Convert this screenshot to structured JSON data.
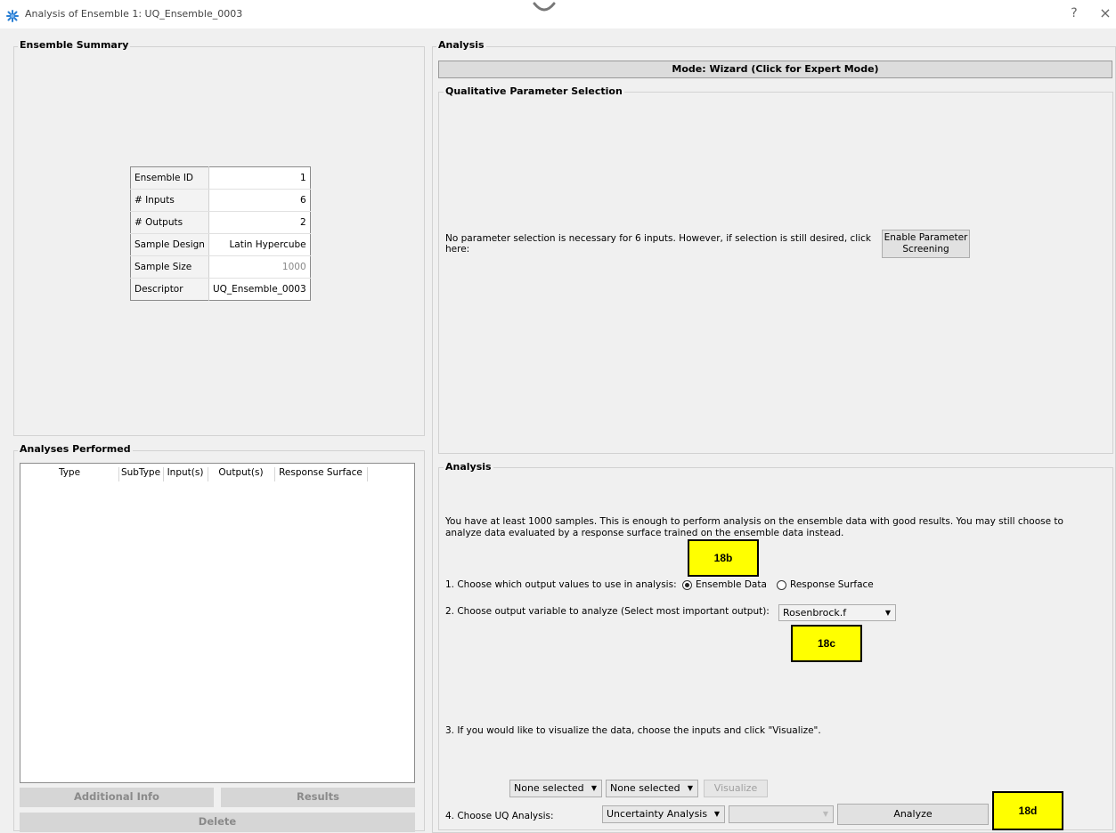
{
  "window": {
    "title": "Analysis of Ensemble 1: UQ_Ensemble_0003",
    "help_label": "?",
    "close_label": "×"
  },
  "ensemble_summary": {
    "title": "Ensemble Summary",
    "rows": [
      {
        "label": "Ensemble ID",
        "value": "1"
      },
      {
        "label": "# Inputs",
        "value": "6"
      },
      {
        "label": "# Outputs",
        "value": "2"
      },
      {
        "label": "Sample Design",
        "value": "Latin Hypercube"
      },
      {
        "label": "Sample Size",
        "value": "1000"
      },
      {
        "label": "Descriptor",
        "value": "UQ_Ensemble_0003"
      }
    ]
  },
  "analyses_performed": {
    "title": "Analyses Performed",
    "columns": [
      "Type",
      "SubType",
      "Input(s)",
      "Output(s)",
      "Response Surface"
    ],
    "buttons": {
      "additional_info": "Additional Info",
      "results": "Results",
      "delete": "Delete"
    }
  },
  "analysis_group": {
    "title": "Analysis",
    "mode_button": "Mode: Wizard (Click for Expert Mode)"
  },
  "qualitative": {
    "title": "Qualitative Parameter Selection",
    "message": "No parameter selection is necessary for 6 inputs. However, if selection is still desired, click here:",
    "enable_button_line1": "Enable Parameter",
    "enable_button_line2": "Screening"
  },
  "analysis_inner": {
    "title": "Analysis",
    "info_line1": "You have at least 1000 samples. This is enough to perform analysis on the ensemble data with good results. You may still choose to",
    "info_line2": "analyze data evaluated by a response surface trained on the ensemble data instead.",
    "step1_label": "1. Choose which output values to use in analysis:",
    "radio_ensemble": "Ensemble Data",
    "radio_response": "Response Surface",
    "radio_selected": "Ensemble Data",
    "step2_label": "2. Choose output variable to analyze (Select most important output):",
    "output_select": "Rosenbrock.f",
    "step3_label": "3. If you would like to visualize the data, choose the inputs and click \"Visualize\".",
    "vis_select1": "None selected",
    "vis_select2": "None selected",
    "visualize_button": "Visualize",
    "step4_label": "4. Choose UQ Analysis:",
    "uq_select": "Uncertainty Analysis",
    "uq_subselect": "",
    "analyze_button": "Analyze"
  },
  "callouts": {
    "c18b": "18b",
    "c18c": "18c",
    "c18d": "18d"
  },
  "colors": {
    "callout_fill": "#ffff00",
    "window_bg": "#f0f0f0",
    "disabled_button": "#d6d6d6"
  }
}
